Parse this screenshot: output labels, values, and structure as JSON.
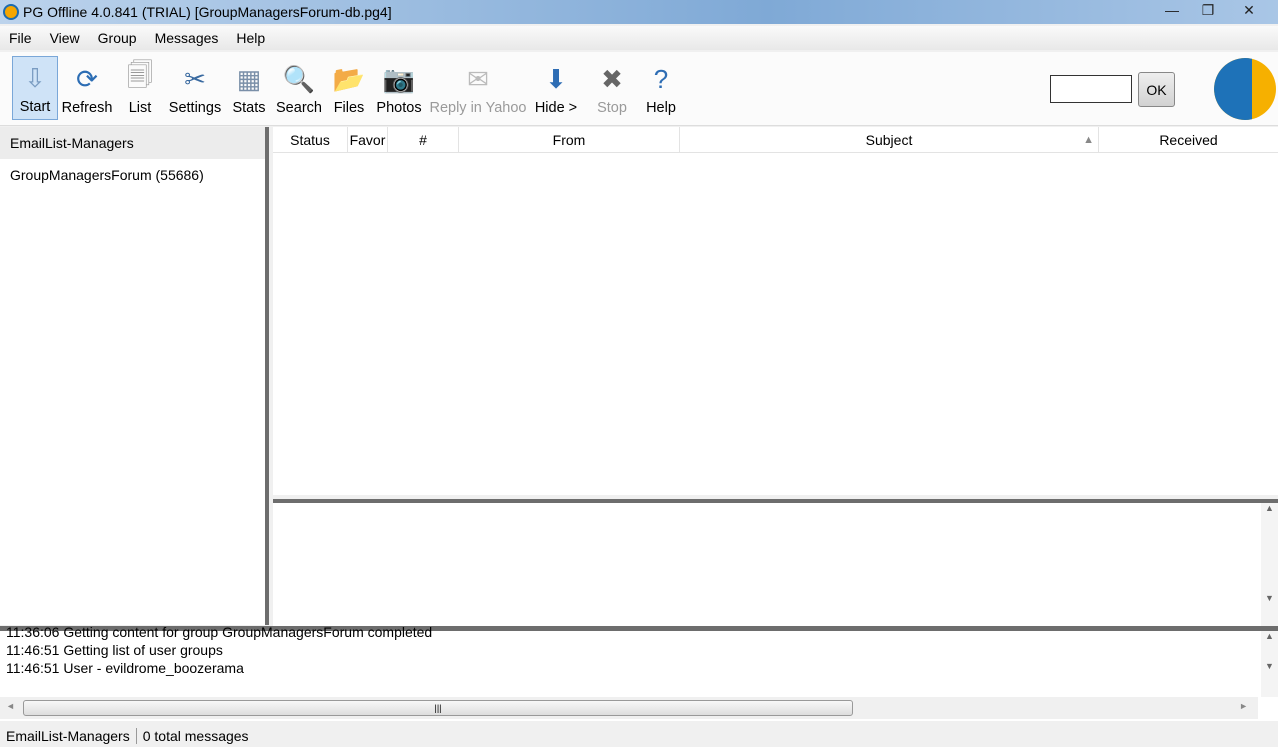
{
  "window": {
    "title": "PG Offline 4.0.841 (TRIAL) [GroupManagersForum-db.pg4]",
    "minimize": "—",
    "maximize": "❐",
    "close": "✕"
  },
  "menu": [
    "File",
    "View",
    "Group",
    "Messages",
    "Help"
  ],
  "toolbar": [
    {
      "label": "Start",
      "icon": "start-icon",
      "glyph": "⇩",
      "color": "#7a9cc2",
      "state": "active"
    },
    {
      "label": "Refresh",
      "icon": "refresh-icon",
      "glyph": "⟳",
      "color": "#2c6db4"
    },
    {
      "label": "List",
      "icon": "list-icon",
      "glyph": "🗐",
      "color": "#999"
    },
    {
      "label": "Settings",
      "icon": "settings-icon",
      "glyph": "✂",
      "color": "#3a6aa0"
    },
    {
      "label": "Stats",
      "icon": "stats-icon",
      "glyph": "▦",
      "color": "#7a8fa8"
    },
    {
      "label": "Search",
      "icon": "search-icon",
      "glyph": "🔍",
      "color": "#2f8a4a"
    },
    {
      "label": "Files",
      "icon": "files-icon",
      "glyph": "📂",
      "color": "#3f7fc4"
    },
    {
      "label": "Photos",
      "icon": "photos-icon",
      "glyph": "📷",
      "color": "#333"
    },
    {
      "label": "Reply in Yahoo",
      "icon": "reply-icon",
      "glyph": "✉",
      "color": "#bbb",
      "state": "disabled"
    },
    {
      "label": "Hide >",
      "icon": "arrow-down-icon",
      "glyph": "⬇",
      "color": "#2e6db4"
    },
    {
      "label": "Stop",
      "icon": "stop-icon",
      "glyph": "✖",
      "color": "#666",
      "state": "disabled"
    },
    {
      "label": "Help",
      "icon": "help-icon",
      "glyph": "?",
      "color": "#2e6db4"
    }
  ],
  "ok_button": "OK",
  "left_panel": {
    "header": "EmailList-Managers",
    "items": [
      "GroupManagersForum (55686)"
    ]
  },
  "columns": [
    "Status",
    "Favor",
    "#",
    "From",
    "Subject",
    "Received"
  ],
  "sort_column": "Subject",
  "log": [
    "11:36:06 Getting content for group GroupManagersForum completed",
    "11:46:51 Getting list of user groups",
    "11:46:51 User - evildrome_boozerama"
  ],
  "status": {
    "group": "EmailList-Managers",
    "messages": "0 total messages"
  }
}
